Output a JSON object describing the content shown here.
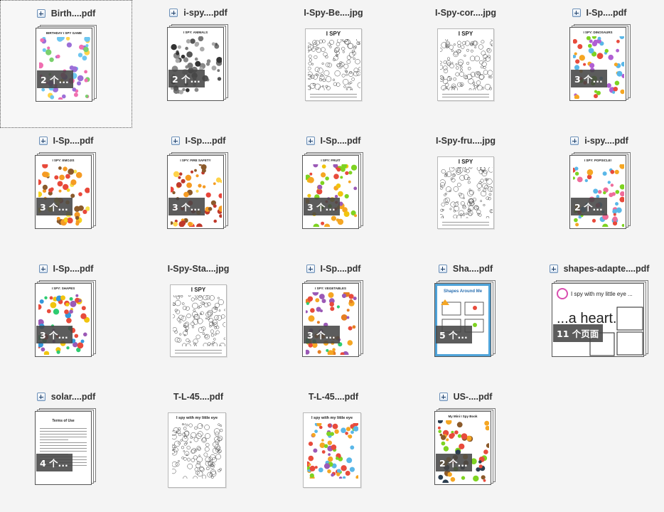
{
  "files": [
    {
      "name": "Birth....pdf",
      "count": "2 个...",
      "expander": true,
      "kind": "stack",
      "colors": [
        "#f06fb1",
        "#ffd54a",
        "#6ec6f0",
        "#9c6fd8",
        "#7ad06d"
      ],
      "sheet_title": "BIRTHDAY I SPY GAME"
    },
    {
      "name": "i-spy....pdf",
      "count": "2 个...",
      "expander": true,
      "kind": "stack",
      "colors": [
        "#555555",
        "#888888",
        "#333333",
        "#777777",
        "#aaaaaa"
      ],
      "sheet_title": "I SPY: ANIMALS"
    },
    {
      "name": "I-Spy-Be....jpg",
      "count": "",
      "expander": false,
      "kind": "jpg",
      "colors": [
        "#666666",
        "#999999",
        "#444444",
        "#bbbbbb",
        "#777777"
      ],
      "sheet_title": "I SPY"
    },
    {
      "name": "I-Spy-cor....jpg",
      "count": "",
      "expander": false,
      "kind": "jpg",
      "colors": [
        "#666666",
        "#999999",
        "#444444",
        "#bbbbbb",
        "#777777"
      ],
      "sheet_title": "I SPY"
    },
    {
      "name": "I-Sp....pdf",
      "count": "3 个...",
      "expander": true,
      "kind": "stack",
      "colors": [
        "#e84b3c",
        "#5ab7e8",
        "#f5a623",
        "#7ed321",
        "#b05fd3"
      ],
      "sheet_title": "I SPY: DINOSAURS"
    },
    {
      "name": "I-Sp....pdf",
      "count": "3 个...",
      "expander": true,
      "kind": "stack",
      "colors": [
        "#f7d21c",
        "#e8493a",
        "#8b5a2b",
        "#f59b23",
        "#f7e04a"
      ],
      "sheet_title": "I SPY: EMOJIS"
    },
    {
      "name": "I-Sp....pdf",
      "count": "3 个...",
      "expander": true,
      "kind": "stack",
      "colors": [
        "#e8453a",
        "#f59b23",
        "#ffd34a",
        "#c0392b",
        "#8b5a2b"
      ],
      "sheet_title": "I SPY: FIRE SAFETY"
    },
    {
      "name": "I-Sp....pdf",
      "count": "3 个...",
      "expander": true,
      "kind": "stack",
      "colors": [
        "#e84b3c",
        "#7ed321",
        "#f5a623",
        "#9b59b6",
        "#f1c40f"
      ],
      "sheet_title": "I SPY: FRUIT"
    },
    {
      "name": "I-Spy-fru....jpg",
      "count": "",
      "expander": false,
      "kind": "jpg",
      "colors": [
        "#666666",
        "#999999",
        "#444444",
        "#bbbbbb",
        "#777777"
      ],
      "sheet_title": "I SPY"
    },
    {
      "name": "i-spy....pdf",
      "count": "2 个...",
      "expander": true,
      "kind": "stack",
      "colors": [
        "#ef6c9a",
        "#5ab7e8",
        "#f5a623",
        "#7ed321",
        "#e8493a"
      ],
      "sheet_title": "I SPY: POPSICLE!"
    },
    {
      "name": "I-Sp....pdf",
      "count": "3 个...",
      "expander": true,
      "kind": "stack",
      "colors": [
        "#e84b3c",
        "#3498db",
        "#2ecc71",
        "#f1c40f",
        "#9b59b6"
      ],
      "sheet_title": "I SPY: SHAPES"
    },
    {
      "name": "I-Spy-Sta....jpg",
      "count": "",
      "expander": false,
      "kind": "jpg",
      "colors": [
        "#555555",
        "#999999",
        "#333333",
        "#bbbbbb",
        "#777777"
      ],
      "sheet_title": "I SPY"
    },
    {
      "name": "I-Sp....pdf",
      "count": "3 个...",
      "expander": true,
      "kind": "stack",
      "colors": [
        "#2ecc71",
        "#e84b3c",
        "#f5a623",
        "#9b59b6",
        "#e67e22"
      ],
      "sheet_title": "I SPY: VEGETABLES"
    },
    {
      "name": "Sha....pdf",
      "count": "5 个...",
      "expander": true,
      "kind": "shapes",
      "colors": [
        "#4fa3d9",
        "#f5a623",
        "#e84b3c",
        "#7ed321",
        "#ffffff"
      ],
      "sheet_title": "Shapes Around Me"
    },
    {
      "name": "shapes-adapte....pdf",
      "count": "11 个页面",
      "expander": true,
      "kind": "wide",
      "colors": [
        "#d94fb0",
        "#333333",
        "#333333",
        "#333333",
        "#333333"
      ],
      "sheet_title": "I spy with my little eye ...",
      "sheet_subtitle": "...a heart."
    },
    {
      "name": "solar....pdf",
      "count": "4 个...",
      "expander": true,
      "kind": "text",
      "colors": [
        "#333333",
        "#333333",
        "#333333",
        "#333333",
        "#333333"
      ],
      "sheet_title": "Terms of Use"
    },
    {
      "name": "T-L-45....pdf",
      "count": "",
      "expander": false,
      "kind": "tl",
      "colors": [
        "#888888",
        "#aaaaaa",
        "#666666",
        "#cccccc",
        "#999999"
      ],
      "sheet_title": "I spy with my little eye"
    },
    {
      "name": "T-L-45....pdf",
      "count": "",
      "expander": false,
      "kind": "tl",
      "colors": [
        "#e84b3c",
        "#5ab7e8",
        "#f5a623",
        "#7ed321",
        "#9b59b6"
      ],
      "sheet_title": "I spy with my little eye"
    },
    {
      "name": "US-....pdf",
      "count": "2 个...",
      "expander": true,
      "kind": "stack",
      "colors": [
        "#f5a623",
        "#e84b3c",
        "#8b5a2b",
        "#2c3e50",
        "#7ed321"
      ],
      "sheet_title": "My Mini I Spy Book"
    }
  ]
}
